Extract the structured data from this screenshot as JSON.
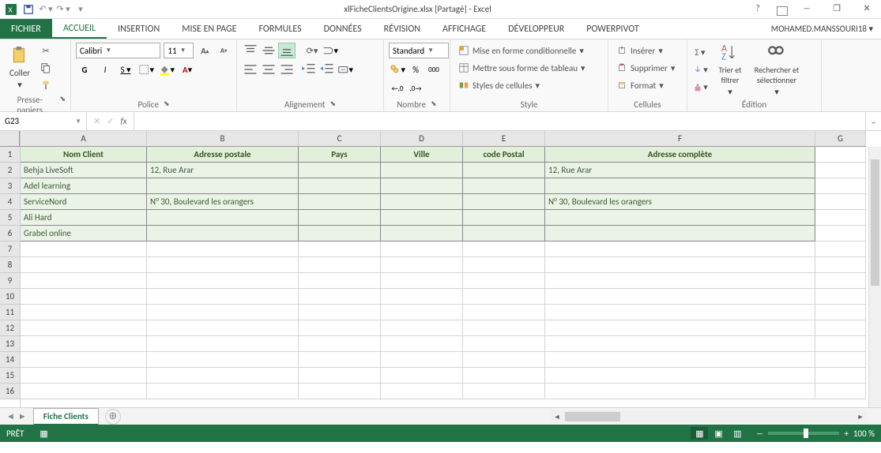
{
  "app": {
    "title": "xlFicheClientsOrigine.xlsx  [Partagé] - Excel",
    "user": "MOHAMED.MANSSOURI18"
  },
  "tabs": {
    "file": "FICHIER",
    "home": "ACCUEIL",
    "insert": "INSERTION",
    "layout": "MISE EN PAGE",
    "formulas": "FORMULES",
    "data": "DONNÉES",
    "review": "RÉVISION",
    "view": "AFFICHAGE",
    "dev": "DÉVELOPPEUR",
    "pp": "POWERPIVOT"
  },
  "ribbon": {
    "paste": "Coller",
    "clipboard": "Presse-papiers",
    "font_name": "Calibri",
    "font_size": "11",
    "font": "Police",
    "alignment": "Alignement",
    "number": "Nombre",
    "number_format": "Standard",
    "condfmt": "Mise en forme conditionnelle",
    "table": "Mettre sous forme de tableau",
    "cellstyles": "Styles de cellules",
    "style": "Style",
    "insertc": "Insérer",
    "deletec": "Supprimer",
    "formatc": "Format",
    "cells": "Cellules",
    "sortfilter": "Trier et filtrer",
    "findselect": "Rechercher et sélectionner",
    "editing": "Édition"
  },
  "fx": {
    "name": "G23",
    "formula": ""
  },
  "columns": [
    "A",
    "B",
    "C",
    "D",
    "E",
    "F",
    "G"
  ],
  "rownums": [
    "1",
    "2",
    "3",
    "4",
    "5",
    "6",
    "7",
    "8",
    "9",
    "10",
    "11",
    "12",
    "13",
    "14",
    "15",
    "16"
  ],
  "headers": {
    "A": "Nom Client",
    "B": "Adresse postale",
    "C": "Pays",
    "D": "Ville",
    "E": "code Postal",
    "F": "Adresse complète"
  },
  "data": [
    {
      "A": "Behja LiveSoft",
      "B": "12, Rue Arar",
      "C": "",
      "D": "",
      "E": "",
      "F": "12, Rue Arar"
    },
    {
      "A": "Adel learning",
      "B": "",
      "C": "",
      "D": "",
      "E": "",
      "F": ""
    },
    {
      "A": "ServiceNord",
      "B": "N° 30, Boulevard les orangers",
      "C": "",
      "D": "",
      "E": "",
      "F": "N° 30, Boulevard les orangers"
    },
    {
      "A": "Ali Hard",
      "B": "",
      "C": "",
      "D": "",
      "E": "",
      "F": ""
    },
    {
      "A": "Grabel online",
      "B": "",
      "C": "",
      "D": "",
      "E": "",
      "F": ""
    }
  ],
  "sheet": {
    "tab": "Fiche Clients",
    "status": "PRÊT",
    "zoom": "100 %"
  }
}
